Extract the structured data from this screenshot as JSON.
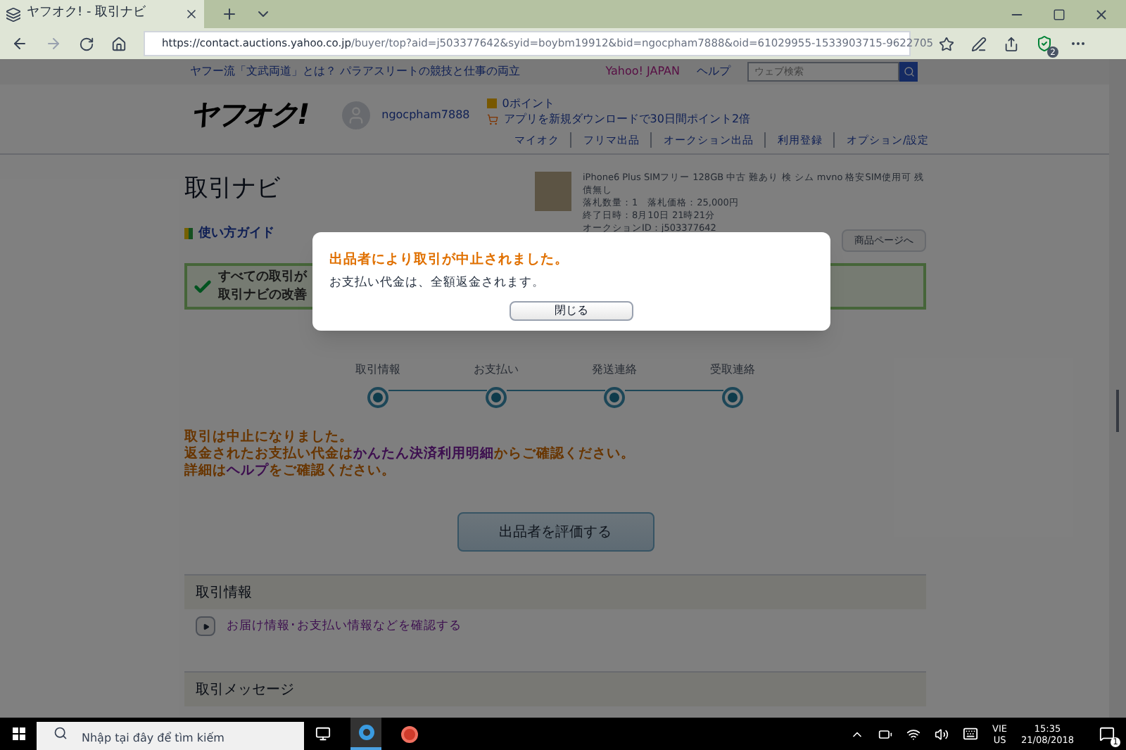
{
  "browser": {
    "tab_title": "ヤフオク! - 取引ナビ",
    "url_host": "https://contact.auctions.yahoo.co.jp",
    "url_path": "/buyer/top?aid=j503377642&syid=boybm19912&bid=ngocpham7888&oid=61029955-1533903715-9622705",
    "shield_badge": "2"
  },
  "page": {
    "top_link": "ヤフー流「文武両道」とは？ パラアスリートの競技と仕事の両立",
    "yahoo_japan": "Yahoo! JAPAN",
    "help": "ヘルプ",
    "search": {
      "placeholder": "ウェブ検索"
    },
    "logo": "ヤフオク!",
    "username": "ngocpham7888",
    "points": "0ポイント",
    "promo": "アプリを新規ダウンロードで30日間ポイント2倍",
    "nav": [
      "マイオク",
      "フリマ出品",
      "オークション出品",
      "利用登録",
      "オプション/設定"
    ],
    "title": "取引ナビ",
    "guide": "使い方ガイド",
    "product": {
      "name": "iPhone6 Plus SIMフリー 128GB 中古 難あり 検 シム mvno 格安SIM使用可 残債無し",
      "quantity": "落札数量：1　落札価格：25,000円",
      "end": "終了日時：8月10日 21時21分",
      "auction_id": "オークションID：j503377642",
      "button": "商品ページへ"
    },
    "notice": [
      "すべての取引が",
      "取引ナビの改善"
    ],
    "steps": [
      {
        "label": "取引情報"
      },
      {
        "label": "お支払い"
      },
      {
        "label": "発送連絡"
      },
      {
        "label": "受取連絡"
      }
    ],
    "messages": [
      [
        {
          "text": "取引は中止になりました。",
          "link": false
        }
      ],
      [
        {
          "text": "返金されたお支払い代金は",
          "link": false
        },
        {
          "text": "かんたん決済利用明細",
          "link": true
        },
        {
          "text": "からご確認ください。",
          "link": false
        }
      ],
      [
        {
          "text": "詳細は",
          "link": false
        },
        {
          "text": "ヘルプ",
          "link": true
        },
        {
          "text": "をご確認ください。",
          "link": false
        }
      ]
    ],
    "rate_button": "出品者を評価する",
    "sections": [
      {
        "title": "取引情報",
        "link": "お届け情報･お支払い情報などを確認する"
      },
      {
        "title": "取引メッセージ"
      }
    ]
  },
  "dialog": {
    "title": "出品者により取引が中止されました。",
    "message": "お支払い代金は、全額返金されます。",
    "button": "閉じる"
  },
  "taskbar": {
    "search": {
      "placeholder": "Nhập tại đây để tìm kiếm"
    },
    "lang": "VIE",
    "region": "US",
    "time": "15:35",
    "date": "21/08/2018",
    "notifications": "1"
  }
}
